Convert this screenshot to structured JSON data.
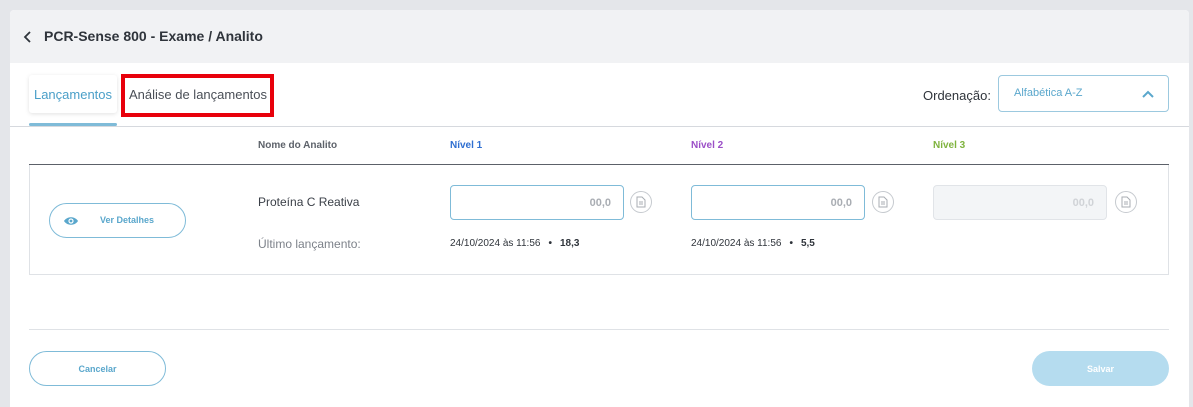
{
  "header": {
    "title": "PCR-Sense 800 - Exame / Analito"
  },
  "tabs": [
    {
      "label": "Lançamentos",
      "active": true
    },
    {
      "label": "Análise de lançamentos",
      "active": false
    }
  ],
  "sort": {
    "label": "Ordenação:",
    "selected": "Alfabética A-Z"
  },
  "columns": {
    "analyte": "Nome do Analito",
    "level1": "Nível 1",
    "level2": "Nível 2",
    "level3": "Nível 3"
  },
  "colors": {
    "level1": "#2f6fd1",
    "level2": "#9b4fc7",
    "level3": "#7fb33e",
    "accent": "#5aa7cc",
    "highlight": "#e8000b"
  },
  "row": {
    "details_label": "Ver Detalhes",
    "analyte_name": "Proteína C Reativa",
    "last_label": "Último lançamento:",
    "level1": {
      "placeholder": "00,0",
      "last_date": "24/10/2024 às 11:56",
      "last_value": "18,3"
    },
    "level2": {
      "placeholder": "00,0",
      "last_date": "24/10/2024 às 11:56",
      "last_value": "5,5"
    },
    "level3": {
      "placeholder": "00,0",
      "disabled": true
    }
  },
  "footer": {
    "cancel_label": "Cancelar",
    "save_label": "Salvar"
  },
  "icons": {
    "back": "chevron-left-icon",
    "sort": "chevron-up-icon",
    "details": "eye-icon",
    "note": "document-icon"
  }
}
